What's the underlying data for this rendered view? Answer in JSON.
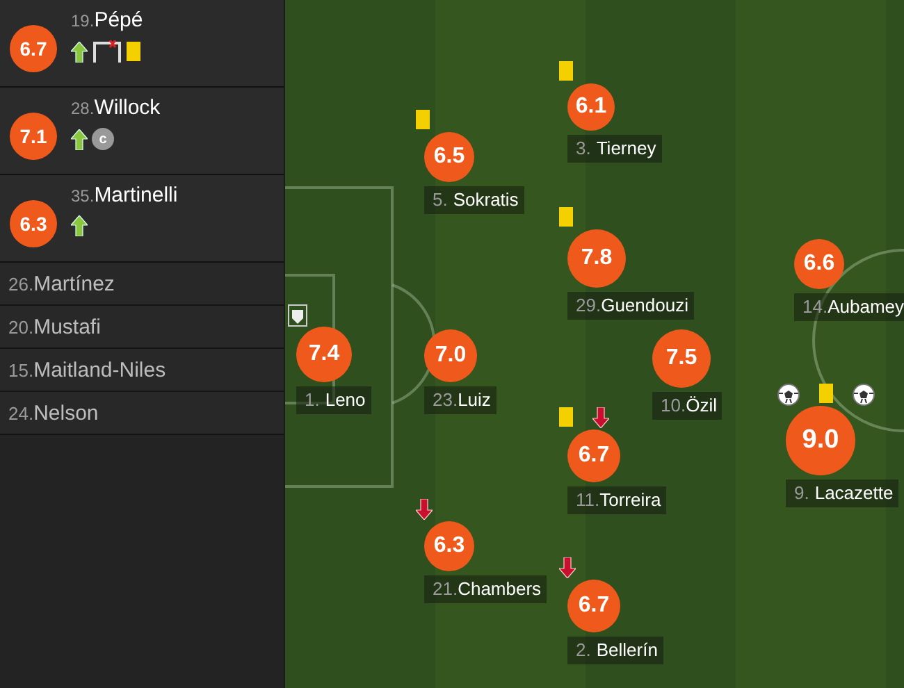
{
  "substitutes": [
    {
      "number": "19.",
      "name": "Pépé",
      "rating": "6.7",
      "events": [
        {
          "kind": "sub_on"
        },
        {
          "kind": "woodwork"
        },
        {
          "kind": "yellow"
        }
      ]
    },
    {
      "number": "28.",
      "name": "Willock",
      "rating": "7.1",
      "events": [
        {
          "kind": "sub_on"
        },
        {
          "kind": "captain",
          "text": "c"
        }
      ]
    },
    {
      "number": "35.",
      "name": "Martinelli",
      "rating": "6.3",
      "events": [
        {
          "kind": "sub_on"
        }
      ]
    }
  ],
  "unused_substitutes": [
    {
      "number": "26.",
      "name": "Martínez"
    },
    {
      "number": "20.",
      "name": "Mustafi"
    },
    {
      "number": "15.",
      "name": "Maitland-Niles"
    },
    {
      "number": "24.",
      "name": "Nelson"
    }
  ],
  "pitch_players": [
    {
      "number": "1.",
      "name": "Leno",
      "rating": "7.4",
      "events": [
        {
          "kind": "save"
        }
      ]
    },
    {
      "number": "5.",
      "name": "Sokratis",
      "rating": "6.5",
      "events": [
        {
          "kind": "yellow"
        }
      ]
    },
    {
      "number": "23.",
      "name": "Luiz",
      "rating": "7.0"
    },
    {
      "number": "21.",
      "name": "Chambers",
      "rating": "6.3",
      "events": [
        {
          "kind": "sub_off"
        }
      ]
    },
    {
      "number": "3.",
      "name": "Tierney",
      "rating": "6.1",
      "events": [
        {
          "kind": "yellow"
        }
      ]
    },
    {
      "number": "29.",
      "name": "Guendouzi",
      "rating": "7.8",
      "events": [
        {
          "kind": "yellow"
        }
      ]
    },
    {
      "number": "11.",
      "name": "Torreira",
      "rating": "6.7",
      "events": [
        {
          "kind": "yellow"
        },
        {
          "kind": "sub_off"
        }
      ]
    },
    {
      "number": "2.",
      "name": "Bellerín",
      "rating": "6.7",
      "events": [
        {
          "kind": "sub_off"
        }
      ]
    },
    {
      "number": "10.",
      "name": "Özil",
      "rating": "7.5"
    },
    {
      "number": "14.",
      "name": "Aubamey",
      "rating": "6.6"
    },
    {
      "number": "9.",
      "name": "Lacazette",
      "rating": "9.0",
      "events": [
        {
          "kind": "goal"
        },
        {
          "kind": "yellow"
        },
        {
          "kind": "goal"
        }
      ]
    }
  ]
}
